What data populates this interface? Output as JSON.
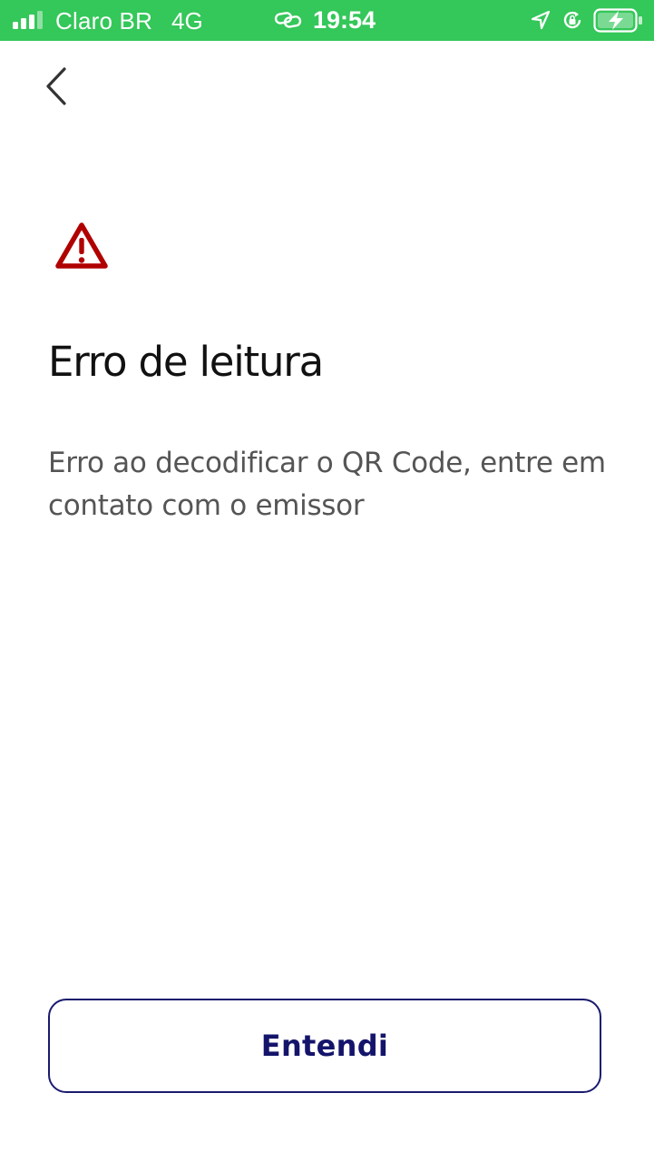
{
  "status_bar": {
    "carrier": "Claro BR",
    "network": "4G",
    "time": "19:54",
    "icons": [
      "signal-icon",
      "link-icon",
      "location-icon",
      "rotation-lock-icon",
      "battery-charging-icon"
    ],
    "background_color": "#34c759"
  },
  "nav": {
    "back_icon": "chevron-left-icon"
  },
  "content": {
    "icon": "warning-triangle-icon",
    "icon_color": "#b00000",
    "title": "Erro de leitura",
    "message": "Erro ao decodificar o QR Code, entre em contato com o emissor"
  },
  "actions": {
    "confirm_label": "Entendi",
    "accent_color": "#14146b"
  }
}
